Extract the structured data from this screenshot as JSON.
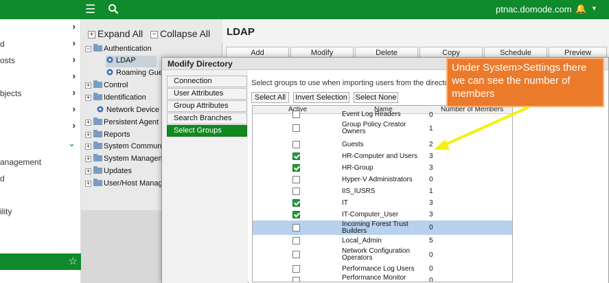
{
  "topbar": {
    "hostname": "ptnac.domode.com",
    "menu_icon": "hamburger-icon",
    "search_icon": "search-icon",
    "bell_icon": "bell-icon"
  },
  "sidebar": {
    "items": [
      {
        "label": "",
        "chevron": "›"
      },
      {
        "label": "d",
        "chevron": "›"
      },
      {
        "label": "osts",
        "chevron": "›"
      },
      {
        "label": "",
        "chevron": "›"
      },
      {
        "label": "bjects",
        "chevron": "›"
      },
      {
        "label": "",
        "chevron": "›"
      },
      {
        "label": "",
        "chevron": "›"
      },
      {
        "label": "",
        "chevron": "⌄"
      },
      {
        "label": "anagement",
        "chevron": ""
      },
      {
        "label": "d",
        "chevron": ""
      },
      {
        "label": "",
        "chevron": ""
      },
      {
        "label": "ility",
        "chevron": ""
      }
    ],
    "star_icon": "☆"
  },
  "tree": {
    "expand_all": "Expand All",
    "collapse_all": "Collapse All",
    "nodes": [
      {
        "label": "Authentication",
        "exp": "−"
      },
      {
        "label": "LDAP",
        "exp": ""
      },
      {
        "label": "Roaming Gues",
        "exp": ""
      },
      {
        "label": "Control",
        "exp": "+"
      },
      {
        "label": "Identification",
        "exp": "+"
      },
      {
        "label": "Network Device",
        "exp": ""
      },
      {
        "label": "Persistent Agent",
        "exp": "+"
      },
      {
        "label": "Reports",
        "exp": "+"
      },
      {
        "label": "System Communic",
        "exp": "+"
      },
      {
        "label": "System Managem",
        "exp": "+"
      },
      {
        "label": "Updates",
        "exp": "+"
      },
      {
        "label": "User/Host Manage",
        "exp": "+"
      }
    ]
  },
  "ldap": {
    "title": "LDAP",
    "actions": [
      "Add",
      "Modify",
      "Delete",
      "Copy",
      "Schedule",
      "Preview"
    ]
  },
  "modal": {
    "title": "Modify Directory",
    "nav": [
      "Connection",
      "User Attributes",
      "Group Attributes",
      "Search Branches",
      "Select Groups"
    ],
    "instruction": "Select groups to use when importing users from the directory",
    "buttons": [
      "Select All",
      "Invert Selection",
      "Select None"
    ],
    "table": {
      "headers": {
        "active": "Active",
        "name": "Name",
        "members": "Number of Members"
      },
      "rows": [
        {
          "name": "Event Log Readers",
          "active": false,
          "members": "0",
          "highlight": false
        },
        {
          "name": "Group Policy Creator Owners",
          "active": false,
          "members": "1",
          "highlight": false
        },
        {
          "name": "Guests",
          "active": false,
          "members": "2",
          "highlight": false
        },
        {
          "name": "HR-Computer and Users",
          "active": true,
          "members": "3",
          "highlight": false
        },
        {
          "name": "HR-Group",
          "active": true,
          "members": "3",
          "highlight": false
        },
        {
          "name": "Hyper-V Administrators",
          "active": false,
          "members": "0",
          "highlight": false
        },
        {
          "name": "IIS_IUSRS",
          "active": false,
          "members": "1",
          "highlight": false
        },
        {
          "name": "IT",
          "active": true,
          "members": "3",
          "highlight": false
        },
        {
          "name": "IT-Computer_User",
          "active": true,
          "members": "3",
          "highlight": false
        },
        {
          "name": "Incoming Forest Trust Builders",
          "active": false,
          "members": "0",
          "highlight": true
        },
        {
          "name": "Local_Admin",
          "active": false,
          "members": "5",
          "highlight": false
        },
        {
          "name": "Network Configuration Operators",
          "active": false,
          "members": "0",
          "highlight": false
        },
        {
          "name": "Performance Log Users",
          "active": false,
          "members": "0",
          "highlight": false
        },
        {
          "name": "Performance Monitor Users",
          "active": false,
          "members": "0",
          "highlight": false
        }
      ]
    }
  },
  "callout": {
    "text": "Under System>Settings there we can see the number of members",
    "bg": "#ec7a2b",
    "arrow_color": "#f2f20a"
  }
}
